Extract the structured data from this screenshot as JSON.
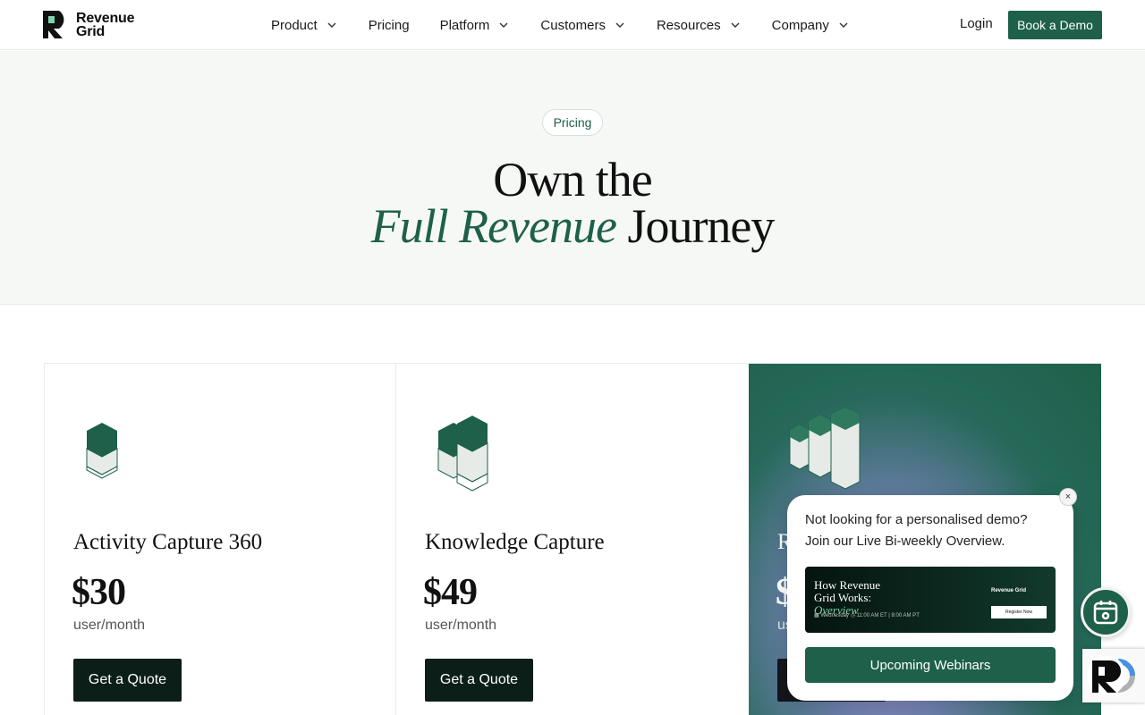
{
  "nav": {
    "logo": {
      "line1": "Revenue",
      "line2": "Grid"
    },
    "items": [
      {
        "label": "Product",
        "dropdown": true
      },
      {
        "label": "Pricing",
        "dropdown": false
      },
      {
        "label": "Platform",
        "dropdown": true
      },
      {
        "label": "Customers",
        "dropdown": true
      },
      {
        "label": "Resources",
        "dropdown": true
      },
      {
        "label": "Company",
        "dropdown": true
      }
    ],
    "login": "Login",
    "cta": "Book a Demo"
  },
  "hero": {
    "pill": "Pricing",
    "title_line1": "Own the",
    "title_italic": "Full Revenue",
    "title_rest": "Journey"
  },
  "plans": [
    {
      "name": "Activity Capture 360",
      "price": "$30",
      "unit": "user/month",
      "cta": "Get a Quote"
    },
    {
      "name": "Knowledge Capture",
      "price": "$49",
      "unit": "user/month",
      "cta": "Get a Quote"
    },
    {
      "name": "R",
      "price": "$",
      "unit": "us",
      "cta": ""
    }
  ],
  "popup": {
    "close": "×",
    "line1": "Not looking for a personalised demo?",
    "line2": "Join our Live Bi-weekly Overview.",
    "banner": {
      "title_line1": "How Revenue",
      "title_line2_plain": "Grid Works: ",
      "title_line2_italic": "Overview",
      "meta": "▦ Wednesday   ◷ 11:00 AM ET | 8:00 AM PT",
      "logo": "Revenue Grid",
      "button": "Register Now"
    },
    "cta": "Upcoming Webinars"
  },
  "colors": {
    "brand": "#1e6049",
    "dark_button": "#0b1f18",
    "hero_bg": "#f6f8f6"
  },
  "icons": [
    "revenue-grid-logo",
    "chevron-down-icon",
    "calendar-icon",
    "recaptcha-logo"
  ]
}
